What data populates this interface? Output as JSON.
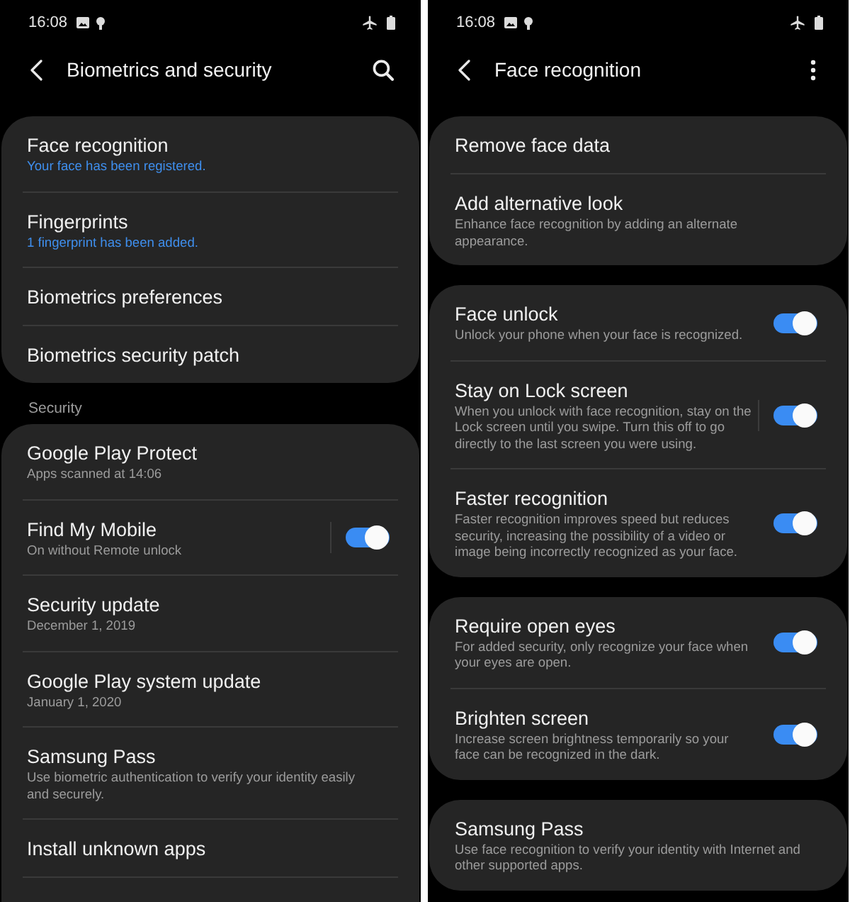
{
  "screens": [
    {
      "status_bar": {
        "time": "16:08"
      },
      "header": {
        "title": "Biometrics and security",
        "kind": "search"
      },
      "sections": [
        {
          "cut_off": false,
          "items": [
            {
              "kind": "link",
              "title": "Face recognition",
              "summary": "Your face has been registered.",
              "summary_highlighted": true
            },
            {
              "kind": "link",
              "title": "Fingerprints",
              "summary": "1 fingerprint has been added.",
              "summary_highlighted": true
            },
            {
              "kind": "link",
              "title": "Biometrics preferences"
            },
            {
              "kind": "link",
              "title": "Biometrics security patch"
            }
          ]
        },
        {
          "label": "Security",
          "cut_off": true,
          "items": [
            {
              "kind": "link",
              "title": "Google Play Protect",
              "summary": "Apps scanned at 14:06",
              "summary_highlighted": false
            },
            {
              "kind": "switch",
              "title": "Find My Mobile",
              "summary": "On without Remote unlock",
              "summary_highlighted": false,
              "on": true,
              "split": true
            },
            {
              "kind": "link",
              "title": "Security update",
              "summary": "December 1, 2019",
              "summary_highlighted": false
            },
            {
              "kind": "link",
              "title": "Google Play system update",
              "summary": "January 1, 2020",
              "summary_highlighted": false
            },
            {
              "kind": "link",
              "title": "Samsung Pass",
              "summary": "Use biometric authentication to verify your identity easily and securely.",
              "summary_highlighted": false
            },
            {
              "kind": "link",
              "title": "Install unknown apps"
            }
          ]
        }
      ]
    },
    {
      "status_bar": {
        "time": "16:08"
      },
      "header": {
        "title": "Face recognition",
        "kind": "more"
      },
      "sections": [
        {
          "cut_off": false,
          "items": [
            {
              "kind": "link",
              "title": "Remove face data"
            },
            {
              "kind": "link",
              "title": "Add alternative look",
              "summary": "Enhance face recognition by adding an alternate appearance.",
              "summary_highlighted": false
            }
          ]
        },
        {
          "cut_off": false,
          "items": [
            {
              "kind": "switch",
              "title": "Face unlock",
              "summary": "Unlock your phone when your face is recognized.",
              "summary_highlighted": false,
              "on": true,
              "split": false
            },
            {
              "kind": "switch",
              "title": "Stay on Lock screen",
              "summary": "When you unlock with face recognition, stay on the Lock screen until you swipe. Turn this off to go directly to the last screen you were using.",
              "summary_highlighted": false,
              "on": true,
              "split": true
            },
            {
              "kind": "switch",
              "title": "Faster recognition",
              "summary": "Faster recognition improves speed but reduces security, increasing the possibility of a video or image being incorrectly recognized as your face.",
              "summary_highlighted": false,
              "on": true,
              "split": false
            }
          ]
        },
        {
          "cut_off": false,
          "items": [
            {
              "kind": "switch",
              "title": "Require open eyes",
              "summary": "For added security, only recognize your face when your eyes are open.",
              "summary_highlighted": false,
              "on": true,
              "split": false
            },
            {
              "kind": "switch",
              "title": "Brighten screen",
              "summary": "Increase screen brightness temporarily so your face can be recognized in the dark.",
              "summary_highlighted": false,
              "on": true,
              "split": false
            }
          ]
        },
        {
          "cut_off": false,
          "items": [
            {
              "kind": "link",
              "title": "Samsung Pass",
              "summary": "Use face recognition to verify your identity with Internet and other supported apps.",
              "summary_highlighted": false
            }
          ]
        }
      ]
    }
  ]
}
